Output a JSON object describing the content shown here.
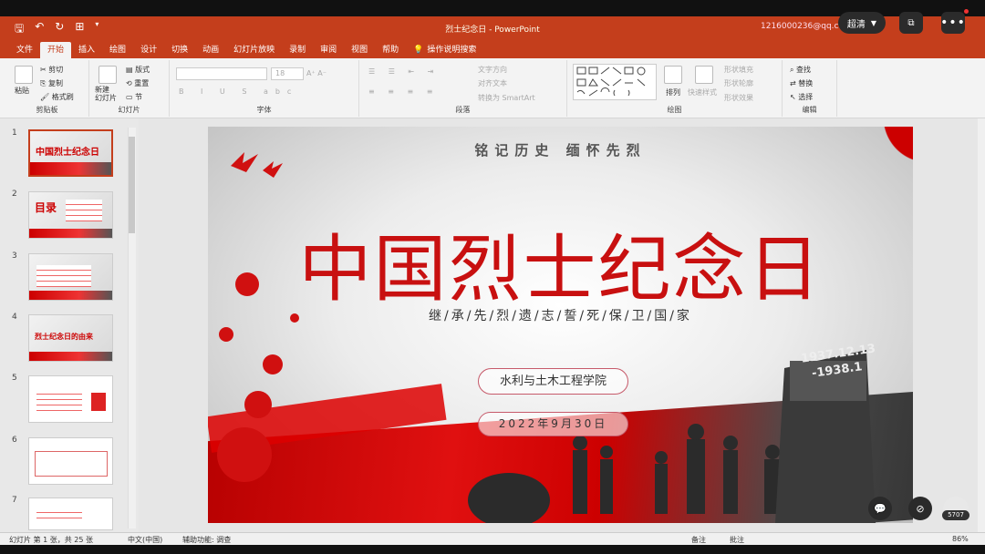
{
  "window": {
    "title": "烈士纪念日 - PowerPoint",
    "account": "1216000236@qq.co..."
  },
  "overlay": {
    "quality_label": "超清",
    "like_count": "5707"
  },
  "tabs": [
    "文件",
    "开始",
    "插入",
    "绘图",
    "设计",
    "切换",
    "动画",
    "幻灯片放映",
    "录制",
    "审阅",
    "视图",
    "帮助"
  ],
  "tell_me": "操作说明搜索",
  "ribbon": {
    "clipboard": {
      "label": "剪贴板",
      "paste": "粘贴",
      "cut": "剪切",
      "copy": "复制",
      "format_painter": "格式刷"
    },
    "slides": {
      "label": "幻灯片",
      "new_slide": "新建\n幻灯片",
      "layout": "版式",
      "reset": "重置",
      "section": "节"
    },
    "font": {
      "label": "字体",
      "size": "18"
    },
    "paragraph": {
      "label": "段落",
      "text_direction": "文字方向",
      "align_text": "对齐文本",
      "smartart": "转换为 SmartArt"
    },
    "drawing": {
      "label": "绘图",
      "arrange": "排列",
      "quick_styles": "快速样式",
      "shape_fill": "形状填充",
      "shape_outline": "形状轮廓",
      "shape_effects": "形状效果"
    },
    "editing": {
      "label": "编辑",
      "find": "查找",
      "replace": "替换",
      "select": "选择"
    }
  },
  "thumbnails": [
    {
      "num": "1",
      "title": "中国烈士纪念日"
    },
    {
      "num": "2",
      "title": "目录"
    },
    {
      "num": "3",
      "title": ""
    },
    {
      "num": "4",
      "title": "烈士纪念日的由来"
    },
    {
      "num": "5",
      "title": ""
    },
    {
      "num": "6",
      "title": ""
    },
    {
      "num": "7",
      "title": ""
    }
  ],
  "slide": {
    "slogan": "铭记历史 缅怀先烈",
    "title": "中国烈士纪念日",
    "subtitle": "继/承/先/烈/遗/志/誓/死/保/卫/国/家",
    "school": "水利与土木工程学院",
    "date": "2022年9月30日",
    "monument_text_1": "1937.12.13",
    "monument_text_2": "-1938.1"
  },
  "status": {
    "slide_info": "幻灯片 第 1 张，共 25 张",
    "language": "中文(中国)",
    "accessibility": "辅助功能: 调查",
    "notes": "备注",
    "comments": "批注",
    "zoom": "86%"
  },
  "colors": {
    "accent": "#c43e1c",
    "title_red": "#c81010"
  }
}
